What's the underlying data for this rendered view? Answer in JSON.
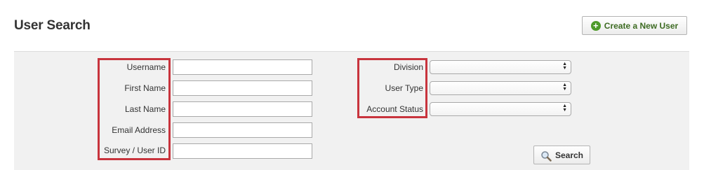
{
  "page": {
    "title": "User Search"
  },
  "header": {
    "create_button_label": "Create a New User",
    "create_button_icon": "plus-circle-icon",
    "accent_color": "#4e9a2a"
  },
  "form": {
    "left_fields": [
      {
        "label": "Username",
        "value": ""
      },
      {
        "label": "First Name",
        "value": ""
      },
      {
        "label": "Last Name",
        "value": ""
      },
      {
        "label": "Email Address",
        "value": ""
      },
      {
        "label": "Survey / User ID",
        "value": ""
      }
    ],
    "right_fields": [
      {
        "label": "Division",
        "selected": ""
      },
      {
        "label": "User Type",
        "selected": ""
      },
      {
        "label": "Account Status",
        "selected": ""
      }
    ],
    "search_button_label": "Search",
    "search_button_icon": "magnifier-icon",
    "highlight_color": "#c8343d"
  }
}
